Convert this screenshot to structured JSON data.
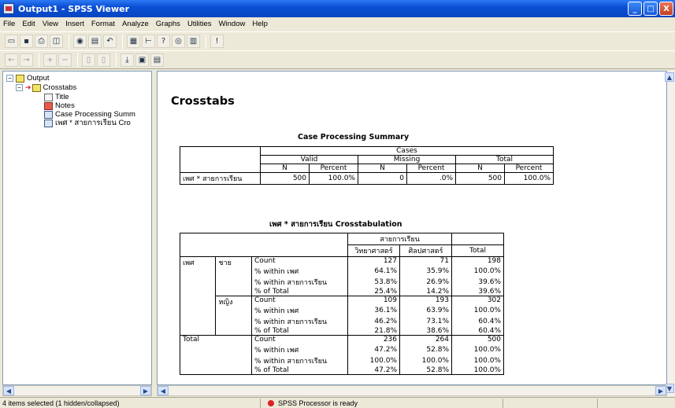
{
  "window": {
    "title": "Output1 - SPSS Viewer",
    "buttons": [
      "_",
      "□",
      "X"
    ]
  },
  "menu": [
    "File",
    "Edit",
    "View",
    "Insert",
    "Format",
    "Analyze",
    "Graphs",
    "Utilities",
    "Window",
    "Help"
  ],
  "toolbar1": [
    "open-icon",
    "save-icon",
    "print-icon",
    "preview-icon",
    "export-icon",
    "dialog-recall-icon",
    "undo-icon",
    "goto-data-icon",
    "goto-case-icon",
    "variables-icon",
    "find-icon",
    "insert-icon",
    "designate-window-icon"
  ],
  "toolbar2": [
    "promote-icon",
    "demote-icon",
    "expand-icon",
    "collapse-icon",
    "show-icon",
    "hide-icon",
    "insert-heading-icon",
    "insert-title-icon",
    "insert-text-icon"
  ],
  "tree": {
    "root": "Output",
    "group": "Crosstabs",
    "items": [
      "Title",
      "Notes",
      "Case Processing Summ",
      "เพศ * สายการเรียน Cro"
    ]
  },
  "content": {
    "heading": "Crosstabs",
    "summary": {
      "title": "Case Processing Summary",
      "cases": "Cases",
      "groups": [
        "Valid",
        "Missing",
        "Total"
      ],
      "subheaders": [
        "N",
        "Percent",
        "N",
        "Percent",
        "N",
        "Percent"
      ],
      "row_label": "เพศ * สายการเรียน",
      "row_values": [
        "500",
        "100.0%",
        "0",
        ".0%",
        "500",
        "100.0%"
      ]
    },
    "crosstab": {
      "title": "เพศ * สายการเรียน Crosstabulation",
      "col_var": "สายการเรียน",
      "col_cats": [
        "วิทยาศาสตร์",
        "ศิลปศาสตร์"
      ],
      "total_label": "Total",
      "row_var": "เพศ",
      "groups": [
        {
          "label": "ชาย",
          "rows": [
            [
              "Count",
              "127",
              "71",
              "198"
            ],
            [
              "% within เพศ",
              "64.1%",
              "35.9%",
              "100.0%"
            ],
            [
              "% within สายการเรียน",
              "53.8%",
              "26.9%",
              "39.6%"
            ],
            [
              "% of Total",
              "25.4%",
              "14.2%",
              "39.6%"
            ]
          ]
        },
        {
          "label": "หญิง",
          "rows": [
            [
              "Count",
              "109",
              "193",
              "302"
            ],
            [
              "% within เพศ",
              "36.1%",
              "63.9%",
              "100.0%"
            ],
            [
              "% within สายการเรียน",
              "46.2%",
              "73.1%",
              "60.4%"
            ],
            [
              "% of Total",
              "21.8%",
              "38.6%",
              "60.4%"
            ]
          ]
        }
      ],
      "total_group": {
        "label": "Total",
        "rows": [
          [
            "Count",
            "236",
            "264",
            "500"
          ],
          [
            "% within เพศ",
            "47.2%",
            "52.8%",
            "100.0%"
          ],
          [
            "% within สายการเรียน",
            "100.0%",
            "100.0%",
            "100.0%"
          ],
          [
            "% of Total",
            "47.2%",
            "52.8%",
            "100.0%"
          ]
        ]
      }
    }
  },
  "status": {
    "selection": "4 items selected (1 hidden/collapsed)",
    "processor": "SPSS Processor  is ready"
  }
}
